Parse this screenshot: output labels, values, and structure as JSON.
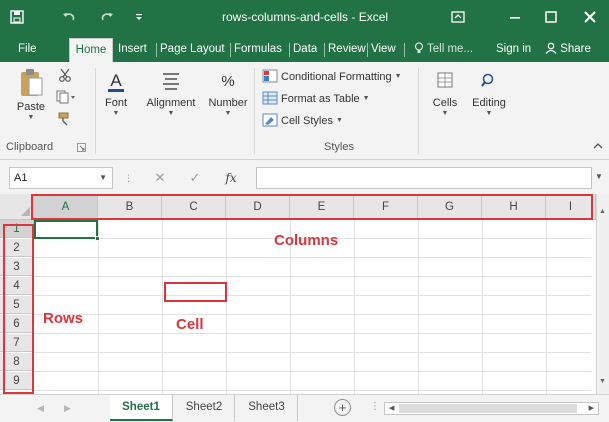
{
  "window": {
    "title": "rows-columns-and-cells - Excel"
  },
  "ribbon_tabs": [
    {
      "label": "File"
    },
    {
      "label": "Home",
      "active": true
    },
    {
      "label": "Insert"
    },
    {
      "label": "Page Layout"
    },
    {
      "label": "Formulas"
    },
    {
      "label": "Data"
    },
    {
      "label": "Review"
    },
    {
      "label": "View"
    }
  ],
  "tell_me": "Tell me...",
  "sign_in": "Sign in",
  "share": "Share",
  "ribbon": {
    "paste_label": "Paste",
    "clipboard_label": "Clipboard",
    "font_label": "Font",
    "alignment_label": "Alignment",
    "number_label": "Number",
    "conditional_formatting": "Conditional Formatting",
    "format_as_table": "Format as Table",
    "cell_styles": "Cell Styles",
    "styles_label": "Styles",
    "cells_label": "Cells",
    "editing_label": "Editing"
  },
  "formula_bar": {
    "name_box": "A1",
    "fx": "fx",
    "formula": ""
  },
  "columns": [
    "A",
    "B",
    "C",
    "D",
    "E",
    "F",
    "G",
    "H",
    "I"
  ],
  "rows": [
    "1",
    "2",
    "3",
    "4",
    "5",
    "6",
    "7",
    "8",
    "9"
  ],
  "selected_cell": "A1",
  "annotations": {
    "columns": "Columns",
    "rows": "Rows",
    "cell": "Cell",
    "color": "#d9363e"
  },
  "sheets": [
    {
      "label": "Sheet1",
      "active": true
    },
    {
      "label": "Sheet2"
    },
    {
      "label": "Sheet3"
    }
  ],
  "colors": {
    "accent": "#217346",
    "annotation": "#d9363e"
  }
}
